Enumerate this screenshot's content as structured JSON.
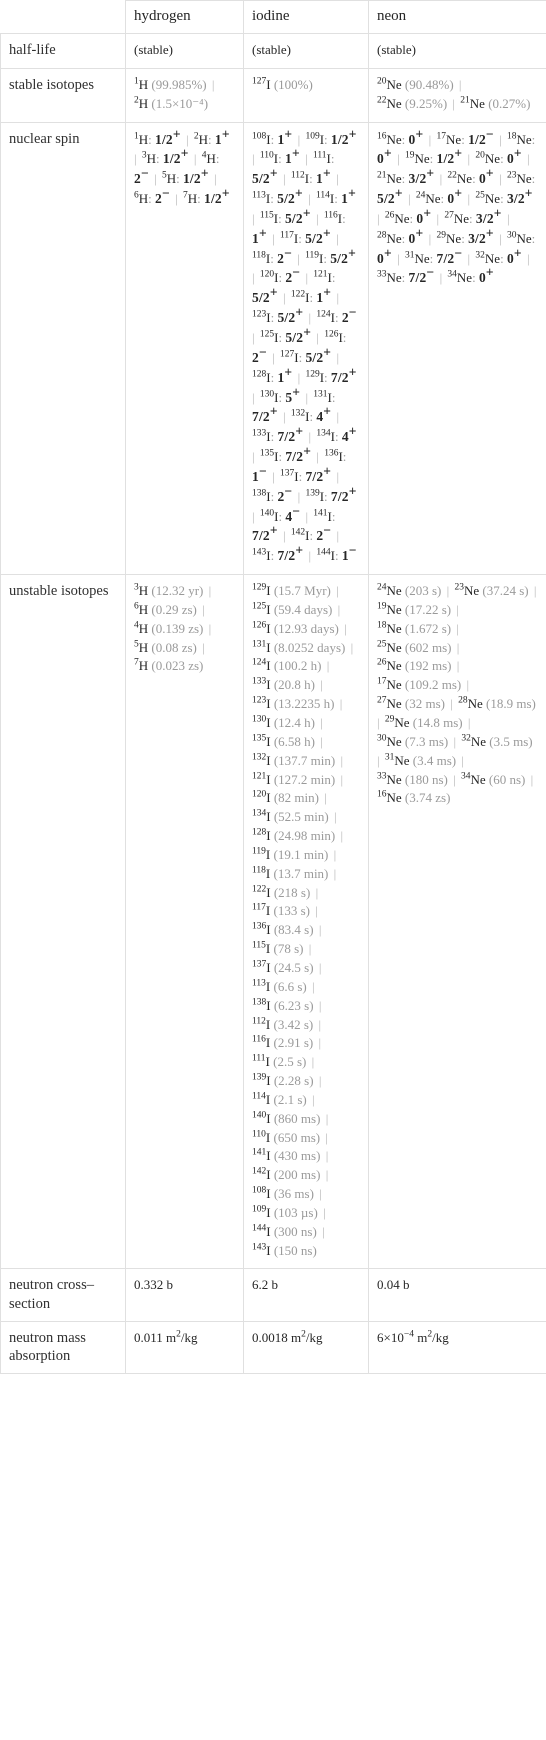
{
  "table": {
    "columns": [
      "",
      "hydrogen",
      "iodine",
      "neon"
    ],
    "rows": [
      {
        "label": "half-life",
        "hydrogen": "(stable)",
        "iodine": "(stable)",
        "neon": "(stable)"
      },
      {
        "label": "stable isotopes"
      },
      {
        "label": "nuclear spin"
      },
      {
        "label": "unstable isotopes"
      },
      {
        "label": "neutron cross-section",
        "hydrogen": "0.332 b",
        "iodine": "6.2 b",
        "neon": "0.04 b"
      },
      {
        "label": "neutron mass absorption",
        "hydrogen": "0.011 m^2/kg",
        "iodine": "0.0018 m^2/kg",
        "neon": "6×10^-4 m^2/kg"
      }
    ]
  },
  "header": {
    "blank": "",
    "hydrogen": "hydrogen",
    "iodine": "iodine",
    "neon": "neon"
  },
  "labels": {
    "half_life": "half-life",
    "stable_isotopes": "stable isotopes",
    "nuclear_spin": "nuclear spin",
    "unstable_isotopes": "unstable isotopes",
    "neutron_cross_section": "neutron cross–section",
    "neutron_mass_absorption": "neutron mass absorption"
  },
  "half_life": {
    "hydrogen": "(stable)",
    "iodine": "(stable)",
    "neon": "(stable)"
  },
  "stable_isotopes": {
    "hydrogen": [
      {
        "mass": "1",
        "sym": "H",
        "note": "(99.985%)"
      },
      {
        "mass": "2",
        "sym": "H",
        "note": "(1.5×10⁻⁴)"
      }
    ],
    "iodine": [
      {
        "mass": "127",
        "sym": "I",
        "note": "(100%)"
      }
    ],
    "neon": [
      {
        "mass": "20",
        "sym": "Ne",
        "note": "(90.48%)"
      },
      {
        "mass": "22",
        "sym": "Ne",
        "note": "(9.25%)"
      },
      {
        "mass": "21",
        "sym": "Ne",
        "note": "(0.27%)"
      }
    ]
  },
  "nuclear_spin": {
    "hydrogen": [
      {
        "mass": "1",
        "sym": "H",
        "spin": "1/2",
        "sign": "+"
      },
      {
        "mass": "2",
        "sym": "H",
        "spin": "1",
        "sign": "+"
      },
      {
        "mass": "3",
        "sym": "H",
        "spin": "1/2",
        "sign": "+"
      },
      {
        "mass": "4",
        "sym": "H",
        "spin": "2",
        "sign": "−"
      },
      {
        "mass": "5",
        "sym": "H",
        "spin": "1/2",
        "sign": "+"
      },
      {
        "mass": "6",
        "sym": "H",
        "spin": "2",
        "sign": "−"
      },
      {
        "mass": "7",
        "sym": "H",
        "spin": "1/2",
        "sign": "+"
      }
    ],
    "iodine": [
      {
        "mass": "108",
        "sym": "I",
        "spin": "1",
        "sign": "+"
      },
      {
        "mass": "109",
        "sym": "I",
        "spin": "1/2",
        "sign": "+"
      },
      {
        "mass": "110",
        "sym": "I",
        "spin": "1",
        "sign": "+"
      },
      {
        "mass": "111",
        "sym": "I",
        "spin": "5/2",
        "sign": "+"
      },
      {
        "mass": "112",
        "sym": "I",
        "spin": "1",
        "sign": "+"
      },
      {
        "mass": "113",
        "sym": "I",
        "spin": "5/2",
        "sign": "+"
      },
      {
        "mass": "114",
        "sym": "I",
        "spin": "1",
        "sign": "+"
      },
      {
        "mass": "115",
        "sym": "I",
        "spin": "5/2",
        "sign": "+"
      },
      {
        "mass": "116",
        "sym": "I",
        "spin": "1",
        "sign": "+"
      },
      {
        "mass": "117",
        "sym": "I",
        "spin": "5/2",
        "sign": "+"
      },
      {
        "mass": "118",
        "sym": "I",
        "spin": "2",
        "sign": "−"
      },
      {
        "mass": "119",
        "sym": "I",
        "spin": "5/2",
        "sign": "+"
      },
      {
        "mass": "120",
        "sym": "I",
        "spin": "2",
        "sign": "−"
      },
      {
        "mass": "121",
        "sym": "I",
        "spin": "5/2",
        "sign": "+"
      },
      {
        "mass": "122",
        "sym": "I",
        "spin": "1",
        "sign": "+"
      },
      {
        "mass": "123",
        "sym": "I",
        "spin": "5/2",
        "sign": "+"
      },
      {
        "mass": "124",
        "sym": "I",
        "spin": "2",
        "sign": "−"
      },
      {
        "mass": "125",
        "sym": "I",
        "spin": "5/2",
        "sign": "+"
      },
      {
        "mass": "126",
        "sym": "I",
        "spin": "2",
        "sign": "−"
      },
      {
        "mass": "127",
        "sym": "I",
        "spin": "5/2",
        "sign": "+"
      },
      {
        "mass": "128",
        "sym": "I",
        "spin": "1",
        "sign": "+"
      },
      {
        "mass": "129",
        "sym": "I",
        "spin": "7/2",
        "sign": "+"
      },
      {
        "mass": "130",
        "sym": "I",
        "spin": "5",
        "sign": "+"
      },
      {
        "mass": "131",
        "sym": "I",
        "spin": "7/2",
        "sign": "+"
      },
      {
        "mass": "132",
        "sym": "I",
        "spin": "4",
        "sign": "+"
      },
      {
        "mass": "133",
        "sym": "I",
        "spin": "7/2",
        "sign": "+"
      },
      {
        "mass": "134",
        "sym": "I",
        "spin": "4",
        "sign": "+"
      },
      {
        "mass": "135",
        "sym": "I",
        "spin": "7/2",
        "sign": "+"
      },
      {
        "mass": "136",
        "sym": "I",
        "spin": "1",
        "sign": "−"
      },
      {
        "mass": "137",
        "sym": "I",
        "spin": "7/2",
        "sign": "+"
      },
      {
        "mass": "138",
        "sym": "I",
        "spin": "2",
        "sign": "−"
      },
      {
        "mass": "139",
        "sym": "I",
        "spin": "7/2",
        "sign": "+"
      },
      {
        "mass": "140",
        "sym": "I",
        "spin": "4",
        "sign": "−"
      },
      {
        "mass": "141",
        "sym": "I",
        "spin": "7/2",
        "sign": "+"
      },
      {
        "mass": "142",
        "sym": "I",
        "spin": "2",
        "sign": "−"
      },
      {
        "mass": "143",
        "sym": "I",
        "spin": "7/2",
        "sign": "+"
      },
      {
        "mass": "144",
        "sym": "I",
        "spin": "1",
        "sign": "−"
      }
    ],
    "neon": [
      {
        "mass": "16",
        "sym": "Ne",
        "spin": "0",
        "sign": "+"
      },
      {
        "mass": "17",
        "sym": "Ne",
        "spin": "1/2",
        "sign": "−"
      },
      {
        "mass": "18",
        "sym": "Ne",
        "spin": "0",
        "sign": "+"
      },
      {
        "mass": "19",
        "sym": "Ne",
        "spin": "1/2",
        "sign": "+"
      },
      {
        "mass": "20",
        "sym": "Ne",
        "spin": "0",
        "sign": "+"
      },
      {
        "mass": "21",
        "sym": "Ne",
        "spin": "3/2",
        "sign": "+"
      },
      {
        "mass": "22",
        "sym": "Ne",
        "spin": "0",
        "sign": "+"
      },
      {
        "mass": "23",
        "sym": "Ne",
        "spin": "5/2",
        "sign": "+"
      },
      {
        "mass": "24",
        "sym": "Ne",
        "spin": "0",
        "sign": "+"
      },
      {
        "mass": "25",
        "sym": "Ne",
        "spin": "3/2",
        "sign": "+"
      },
      {
        "mass": "26",
        "sym": "Ne",
        "spin": "0",
        "sign": "+"
      },
      {
        "mass": "27",
        "sym": "Ne",
        "spin": "3/2",
        "sign": "+"
      },
      {
        "mass": "28",
        "sym": "Ne",
        "spin": "0",
        "sign": "+"
      },
      {
        "mass": "29",
        "sym": "Ne",
        "spin": "3/2",
        "sign": "+"
      },
      {
        "mass": "30",
        "sym": "Ne",
        "spin": "0",
        "sign": "+"
      },
      {
        "mass": "31",
        "sym": "Ne",
        "spin": "7/2",
        "sign": "−"
      },
      {
        "mass": "32",
        "sym": "Ne",
        "spin": "0",
        "sign": "+"
      },
      {
        "mass": "33",
        "sym": "Ne",
        "spin": "7/2",
        "sign": "−"
      },
      {
        "mass": "34",
        "sym": "Ne",
        "spin": "0",
        "sign": "+"
      }
    ]
  },
  "unstable_isotopes": {
    "hydrogen": [
      {
        "mass": "3",
        "sym": "H",
        "half": "(12.32 yr)"
      },
      {
        "mass": "6",
        "sym": "H",
        "half": "(0.29 zs)"
      },
      {
        "mass": "4",
        "sym": "H",
        "half": "(0.139 zs)"
      },
      {
        "mass": "5",
        "sym": "H",
        "half": "(0.08 zs)"
      },
      {
        "mass": "7",
        "sym": "H",
        "half": "(0.023 zs)"
      }
    ],
    "iodine": [
      {
        "mass": "129",
        "sym": "I",
        "half": "(15.7 Myr)"
      },
      {
        "mass": "125",
        "sym": "I",
        "half": "(59.4 days)"
      },
      {
        "mass": "126",
        "sym": "I",
        "half": "(12.93 days)"
      },
      {
        "mass": "131",
        "sym": "I",
        "half": "(8.0252 days)"
      },
      {
        "mass": "124",
        "sym": "I",
        "half": "(100.2 h)"
      },
      {
        "mass": "133",
        "sym": "I",
        "half": "(20.8 h)"
      },
      {
        "mass": "123",
        "sym": "I",
        "half": "(13.2235 h)"
      },
      {
        "mass": "130",
        "sym": "I",
        "half": "(12.4 h)"
      },
      {
        "mass": "135",
        "sym": "I",
        "half": "(6.58 h)"
      },
      {
        "mass": "132",
        "sym": "I",
        "half": "(137.7 min)"
      },
      {
        "mass": "121",
        "sym": "I",
        "half": "(127.2 min)"
      },
      {
        "mass": "120",
        "sym": "I",
        "half": "(82 min)"
      },
      {
        "mass": "134",
        "sym": "I",
        "half": "(52.5 min)"
      },
      {
        "mass": "128",
        "sym": "I",
        "half": "(24.98 min)"
      },
      {
        "mass": "119",
        "sym": "I",
        "half": "(19.1 min)"
      },
      {
        "mass": "118",
        "sym": "I",
        "half": "(13.7 min)"
      },
      {
        "mass": "122",
        "sym": "I",
        "half": "(218 s)"
      },
      {
        "mass": "117",
        "sym": "I",
        "half": "(133 s)"
      },
      {
        "mass": "136",
        "sym": "I",
        "half": "(83.4 s)"
      },
      {
        "mass": "115",
        "sym": "I",
        "half": "(78 s)"
      },
      {
        "mass": "137",
        "sym": "I",
        "half": "(24.5 s)"
      },
      {
        "mass": "113",
        "sym": "I",
        "half": "(6.6 s)"
      },
      {
        "mass": "138",
        "sym": "I",
        "half": "(6.23 s)"
      },
      {
        "mass": "112",
        "sym": "I",
        "half": "(3.42 s)"
      },
      {
        "mass": "116",
        "sym": "I",
        "half": "(2.91 s)"
      },
      {
        "mass": "111",
        "sym": "I",
        "half": "(2.5 s)"
      },
      {
        "mass": "139",
        "sym": "I",
        "half": "(2.28 s)"
      },
      {
        "mass": "114",
        "sym": "I",
        "half": "(2.1 s)"
      },
      {
        "mass": "140",
        "sym": "I",
        "half": "(860 ms)"
      },
      {
        "mass": "110",
        "sym": "I",
        "half": "(650 ms)"
      },
      {
        "mass": "141",
        "sym": "I",
        "half": "(430 ms)"
      },
      {
        "mass": "142",
        "sym": "I",
        "half": "(200 ms)"
      },
      {
        "mass": "108",
        "sym": "I",
        "half": "(36 ms)"
      },
      {
        "mass": "109",
        "sym": "I",
        "half": "(103 µs)"
      },
      {
        "mass": "144",
        "sym": "I",
        "half": "(300 ns)"
      },
      {
        "mass": "143",
        "sym": "I",
        "half": "(150 ns)"
      }
    ],
    "neon": [
      {
        "mass": "24",
        "sym": "Ne",
        "half": "(203 s)"
      },
      {
        "mass": "23",
        "sym": "Ne",
        "half": "(37.24 s)"
      },
      {
        "mass": "19",
        "sym": "Ne",
        "half": "(17.22 s)"
      },
      {
        "mass": "18",
        "sym": "Ne",
        "half": "(1.672 s)"
      },
      {
        "mass": "25",
        "sym": "Ne",
        "half": "(602 ms)"
      },
      {
        "mass": "26",
        "sym": "Ne",
        "half": "(192 ms)"
      },
      {
        "mass": "17",
        "sym": "Ne",
        "half": "(109.2 ms)"
      },
      {
        "mass": "27",
        "sym": "Ne",
        "half": "(32 ms)"
      },
      {
        "mass": "28",
        "sym": "Ne",
        "half": "(18.9 ms)"
      },
      {
        "mass": "29",
        "sym": "Ne",
        "half": "(14.8 ms)"
      },
      {
        "mass": "30",
        "sym": "Ne",
        "half": "(7.3 ms)"
      },
      {
        "mass": "32",
        "sym": "Ne",
        "half": "(3.5 ms)"
      },
      {
        "mass": "31",
        "sym": "Ne",
        "half": "(3.4 ms)"
      },
      {
        "mass": "33",
        "sym": "Ne",
        "half": "(180 ns)"
      },
      {
        "mass": "34",
        "sym": "Ne",
        "half": "(60 ns)"
      },
      {
        "mass": "16",
        "sym": "Ne",
        "half": "(3.74 zs)"
      }
    ]
  },
  "neutron_cross_section": {
    "hydrogen": "0.332 b",
    "iodine": "6.2 b",
    "neon": "0.04 b"
  },
  "neutron_mass_absorption": {
    "hydrogen_value": "0.011 m",
    "hydrogen_unit_sup": "2",
    "hydrogen_unit_tail": "/kg",
    "iodine_value": "0.0018 m",
    "iodine_unit_sup": "2",
    "iodine_unit_tail": "/kg",
    "neon_prefix": "6×10",
    "neon_exp": "−4",
    "neon_value": " m",
    "neon_unit_sup": "2",
    "neon_unit_tail": "/kg"
  },
  "separator": "|"
}
